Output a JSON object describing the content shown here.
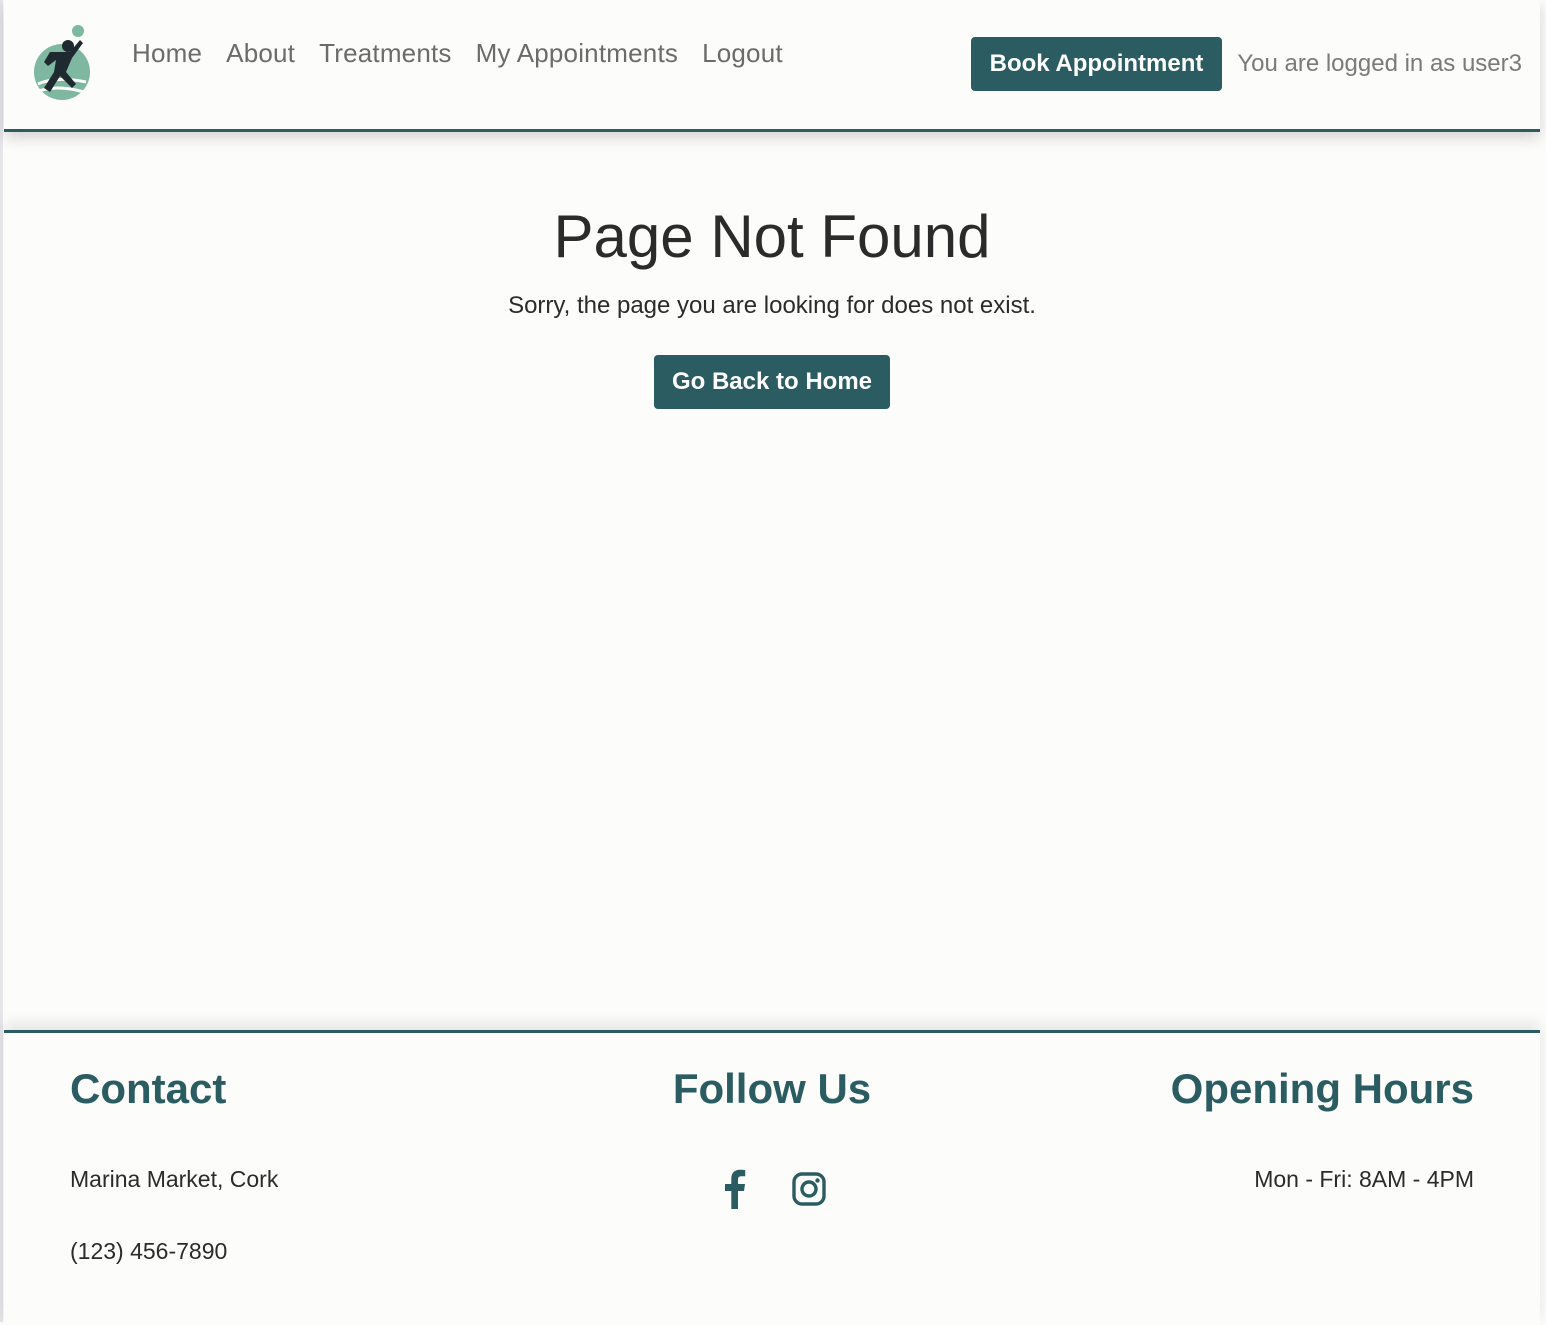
{
  "header": {
    "nav": [
      {
        "label": "Home"
      },
      {
        "label": "About"
      },
      {
        "label": "Treatments"
      },
      {
        "label": "My Appointments"
      },
      {
        "label": "Logout"
      }
    ],
    "book_button": "Book Appointment",
    "logged_in_text": "You are logged in as user3"
  },
  "main": {
    "title": "Page Not Found",
    "message": "Sorry, the page you are looking for does not exist.",
    "home_button": "Go Back to Home"
  },
  "footer": {
    "contact": {
      "heading": "Contact",
      "address": "Marina Market, Cork",
      "phone": "(123) 456-7890"
    },
    "follow": {
      "heading": "Follow Us",
      "icons": [
        "facebook-icon",
        "instagram-icon"
      ]
    },
    "hours": {
      "heading": "Opening Hours",
      "text": "Mon - Fri: 8AM - 4PM"
    }
  },
  "colors": {
    "brand": "#2a5c62",
    "accent_light": "#7fb8a0",
    "background": "#fcfcfa"
  }
}
